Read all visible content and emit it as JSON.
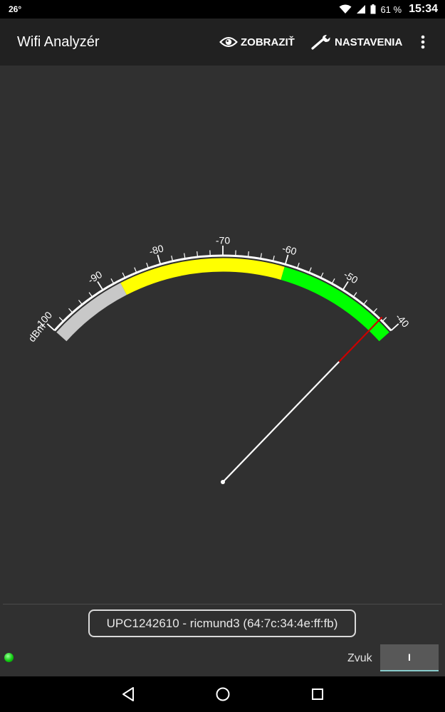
{
  "status_bar": {
    "temperature": "26°",
    "battery": "61 %",
    "clock": "15:34"
  },
  "app_bar": {
    "title": "Wifi Analyzér",
    "view_label": "ZOBRAZIŤ",
    "settings_label": "NASTAVENIA"
  },
  "gauge": {
    "unit": "dBm",
    "min": -100,
    "max": -40,
    "ticks": [
      {
        "value": -100,
        "label": "-100"
      },
      {
        "value": -90,
        "label": "-90"
      },
      {
        "value": -80,
        "label": "-80"
      },
      {
        "value": -70,
        "label": "-70"
      },
      {
        "value": -60,
        "label": "-60"
      },
      {
        "value": -50,
        "label": "-50"
      },
      {
        "value": -40,
        "label": "-40"
      }
    ],
    "zones": [
      {
        "from": -100,
        "to": -87,
        "color": "#c8c8c8"
      },
      {
        "from": -87,
        "to": -60,
        "color": "#ffff00"
      },
      {
        "from": -60,
        "to": -40,
        "color": "#00ff00"
      }
    ],
    "reading": -42.5,
    "needle_color": "#ffffff",
    "needle_tip_color": "#cc0000"
  },
  "network": {
    "label": "UPC1242610 - ricmund3 (64:7c:34:4e:ff:fb)"
  },
  "sound": {
    "label": "Zvuk",
    "toggle_label": "I"
  }
}
